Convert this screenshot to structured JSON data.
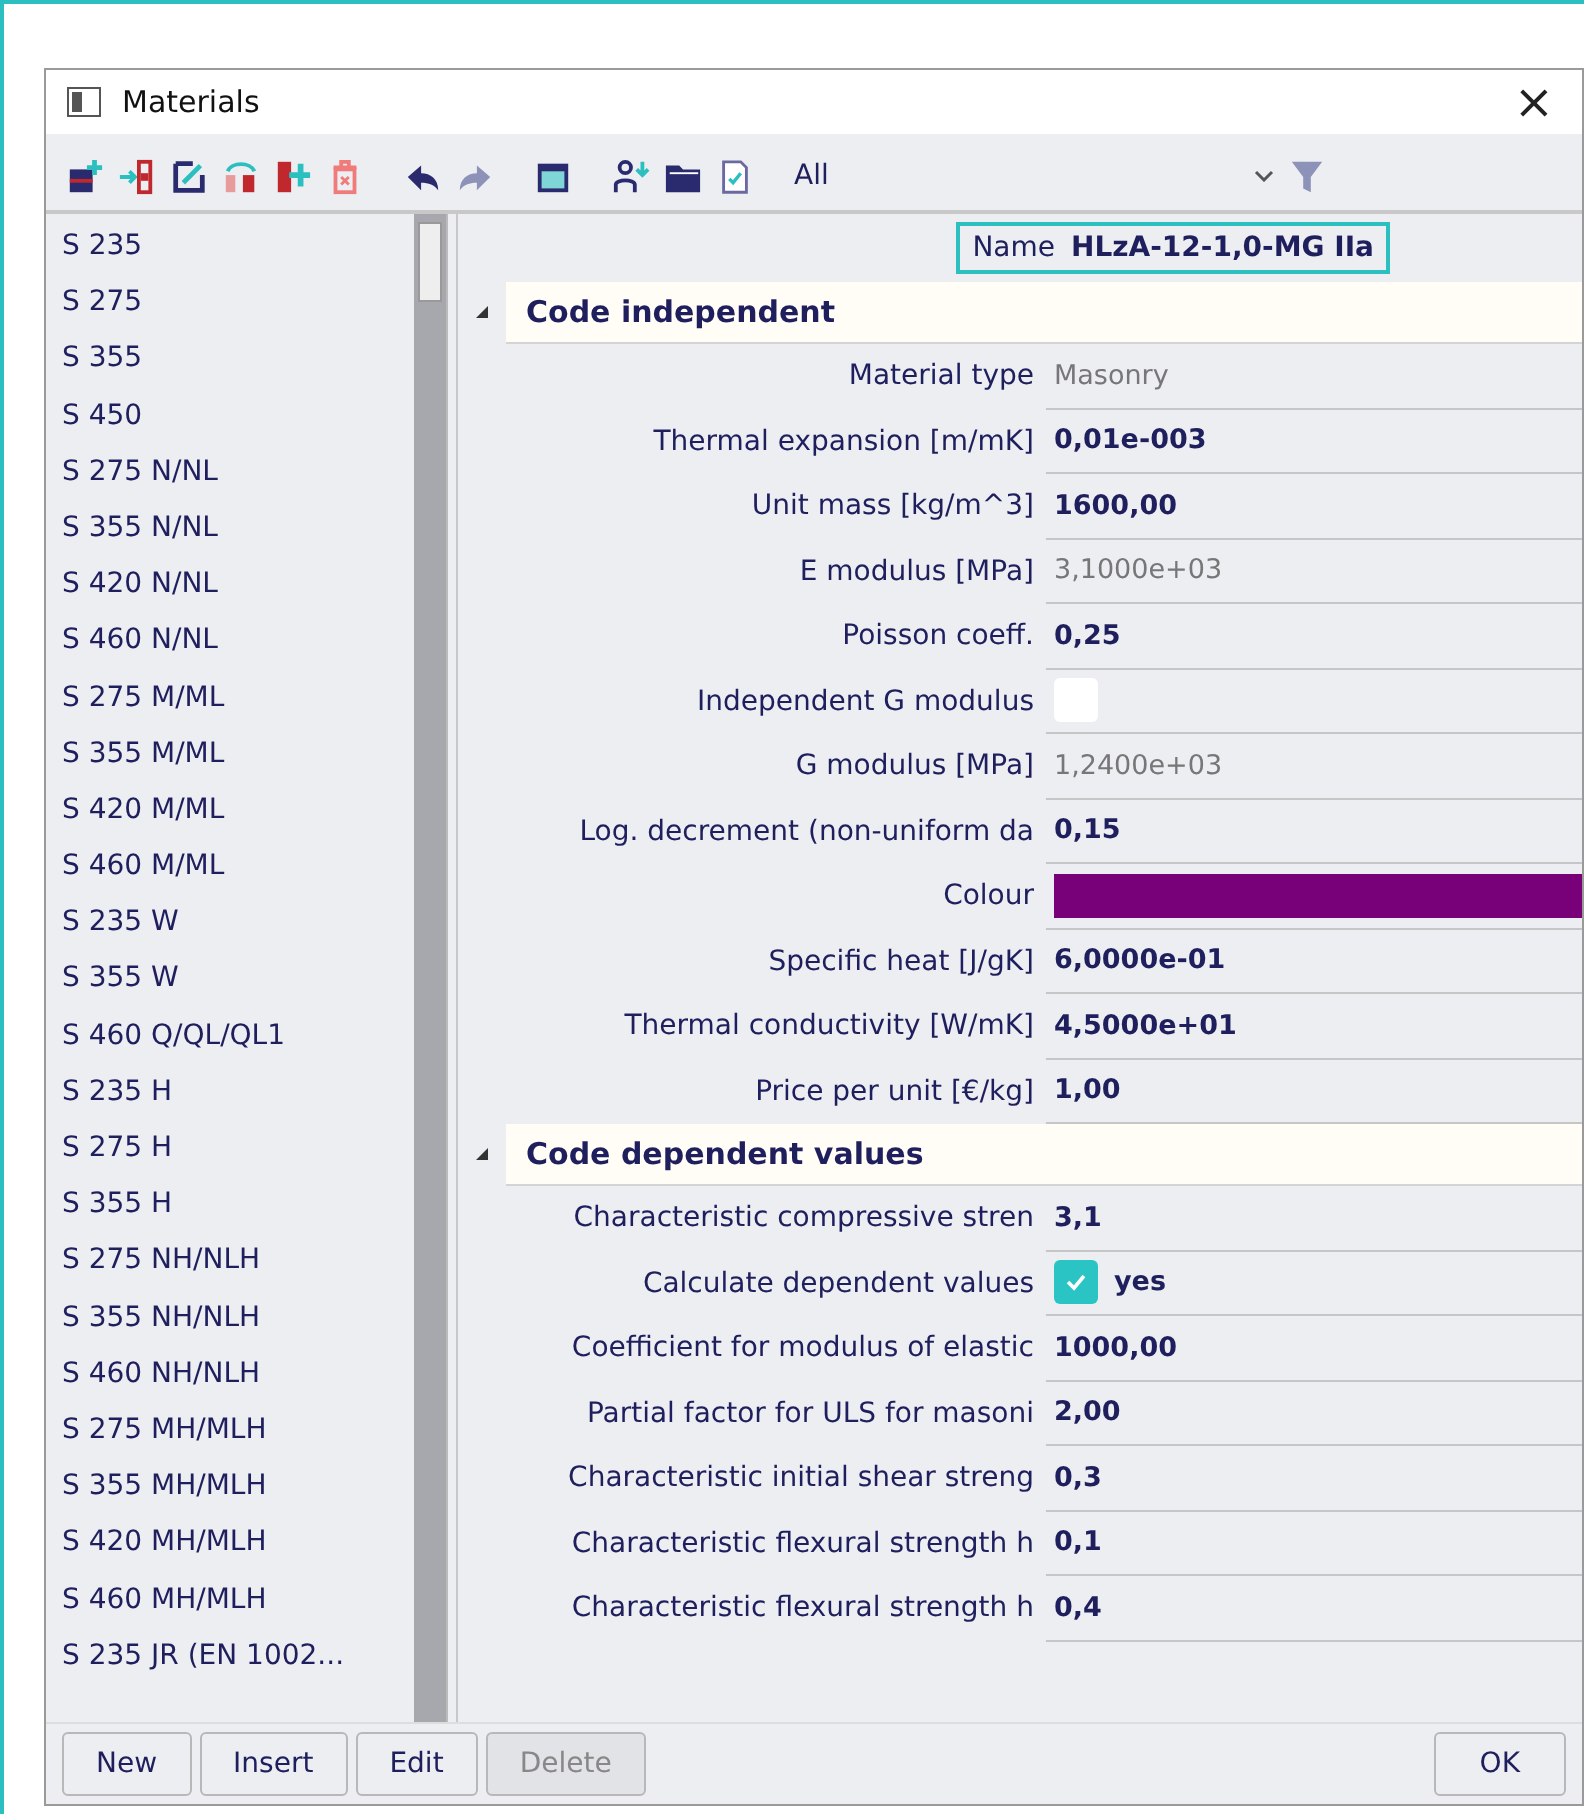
{
  "window": {
    "title": "Materials",
    "close": "×"
  },
  "toolbar": {
    "filter": "All"
  },
  "materials": [
    "S 235",
    "S 275",
    "S 355",
    "S 450",
    "S 275 N/NL",
    "S 355 N/NL",
    "S 420 N/NL",
    "S 460 N/NL",
    "S 275 M/ML",
    "S 355 M/ML",
    "S 420 M/ML",
    "S 460 M/ML",
    "S 235 W",
    "S 355 W",
    "S 460 Q/QL/QL1",
    "S 235 H",
    "S 275 H",
    "S 355 H",
    "S 275 NH/NLH",
    "S 355 NH/NLH",
    "S 460 NH/NLH",
    "S 275 MH/MLH",
    "S 355 MH/MLH",
    "S 420 MH/MLH",
    "S 460 MH/MLH",
    "S 235 JR (EN 1002..."
  ],
  "name": {
    "label": "Name",
    "value": "HLzA-12-1,0-MG IIa"
  },
  "sections": [
    {
      "title": "Code independent",
      "expanded": true,
      "properties": [
        {
          "label": "Material type",
          "kind": "text",
          "value": "Masonry",
          "readonly": true
        },
        {
          "label": "Thermal expansion  [m/mK]",
          "kind": "text",
          "value": "0,01e-003",
          "readonly": false
        },
        {
          "label": "Unit mass [kg/m^3]",
          "kind": "text",
          "value": "1600,00",
          "readonly": false
        },
        {
          "label": "E modulus [MPa]",
          "kind": "text",
          "value": "3,1000e+03",
          "readonly": true
        },
        {
          "label": "Poisson coeff.",
          "kind": "text",
          "value": "0,25",
          "readonly": false
        },
        {
          "label": "Independent G modulus",
          "kind": "checkbox",
          "checked": false
        },
        {
          "label": "G modulus [MPa]",
          "kind": "text",
          "value": "1,2400e+03",
          "readonly": true
        },
        {
          "label": "Log. decrement (non-uniform da",
          "kind": "text",
          "value": "0,15",
          "readonly": false
        },
        {
          "label": "Colour",
          "kind": "color",
          "color": "#780078"
        },
        {
          "label": "Specific heat [J/gK]",
          "kind": "text",
          "value": "6,0000e-01",
          "readonly": false
        },
        {
          "label": "Thermal conductivity [W/mK]",
          "kind": "text",
          "value": "4,5000e+01",
          "readonly": false
        },
        {
          "label": "Price per unit [€/kg]",
          "kind": "text",
          "value": "1,00",
          "readonly": false
        }
      ]
    },
    {
      "title": "Code dependent values",
      "expanded": true,
      "properties": [
        {
          "label": "Characteristic compressive stren",
          "kind": "text",
          "value": "3,1",
          "readonly": false
        },
        {
          "label": "Calculate dependent values",
          "kind": "checkbox",
          "checked": true,
          "value": "yes"
        },
        {
          "label": "Coefficient for modulus of elastic",
          "kind": "text",
          "value": "1000,00",
          "readonly": false
        },
        {
          "label": "Partial factor for ULS for masoni",
          "kind": "text",
          "value": "2,00",
          "readonly": false
        },
        {
          "label": "Characteristic initial shear streng",
          "kind": "text",
          "value": "0,3",
          "readonly": false
        },
        {
          "label": "Characteristic flexural strength h",
          "kind": "text",
          "value": "0,1",
          "readonly": false
        },
        {
          "label": "Characteristic flexural strength h",
          "kind": "text",
          "value": "0,4",
          "readonly": false
        }
      ]
    }
  ],
  "buttons": [
    {
      "label": "New",
      "disabled": false
    },
    {
      "label": "Insert",
      "disabled": false
    },
    {
      "label": "Edit",
      "disabled": false
    },
    {
      "label": "Delete",
      "disabled": true
    }
  ],
  "ok_button": "OK"
}
